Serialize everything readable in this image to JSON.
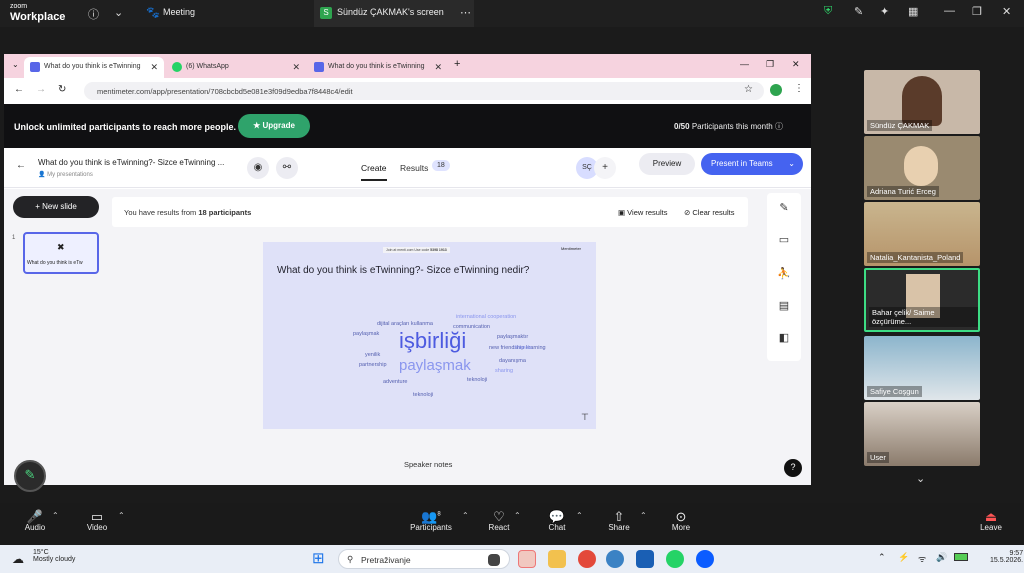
{
  "zoom": {
    "logo_top": "zoom",
    "logo_bottom": "Workplace",
    "meeting_label": "Meeting",
    "share_label": "Sündüz ÇAKMAK's screen",
    "toolbar": {
      "audio": "Audio",
      "video": "Video",
      "participants": "Participants",
      "participants_count": "8",
      "react": "React",
      "chat": "Chat",
      "share": "Share",
      "more": "More",
      "leave": "Leave"
    },
    "participants": [
      {
        "name": "Sündüz ÇAKMAK",
        "color": "#a89a8c"
      },
      {
        "name": "Adriana Turić Erceg",
        "color": "#9a8a70"
      },
      {
        "name": "Natalia_Kantanista_Poland",
        "color": "#b99b72"
      },
      {
        "name": "Bahar çelik/ Saime özçürüme...",
        "color": "#3a3a3a"
      },
      {
        "name": "Safiye Coşgun",
        "color": "#7fa8c0"
      },
      {
        "name": "User",
        "color": "#8b7b6c"
      }
    ]
  },
  "browser": {
    "tabs": [
      {
        "title": "What do you think is eTwinning",
        "color": "#5866e8"
      },
      {
        "title": "(6) WhatsApp",
        "color": "#25d366"
      },
      {
        "title": "What do you think is eTwinning",
        "color": "#5866e8"
      }
    ],
    "url": "mentimeter.com/app/presentation/708cbcbd5e081e3f09d9edba7f8448c4/edit"
  },
  "menti": {
    "banner_text": "Unlock unlimited participants to reach more people.",
    "upgrade_label": "Upgrade",
    "participants_month": "0/50",
    "participants_month_label": "Participants this month",
    "title": "What do you think is eTwinning?- Sizce eTwinning ...",
    "subtitle": "My presentations",
    "tab_create": "Create",
    "tab_results": "Results",
    "results_badge": "18",
    "avatar_initials": "SÇ",
    "preview_label": "Preview",
    "present_label": "Present in Teams",
    "new_slide_label": "New slide",
    "slide_number": "1",
    "thumb_title": "What do you think is eTw",
    "results_text_prefix": "You have results from",
    "results_count": "18 participants",
    "view_results": "View results",
    "clear_results": "Clear results",
    "slide_question": "What do you think is eTwinning?- Sizce eTwinning nedir?",
    "slide_join": "Join at menti.com  Use code",
    "slide_code": "5398 1913",
    "slide_brand": "Mentimeter",
    "speaker_notes": "Speaker notes",
    "help": "?",
    "wordcloud": [
      {
        "word": "işbirliği",
        "size": 22,
        "color": "#4d5be0"
      },
      {
        "word": "paylaşmak",
        "size": 15,
        "color": "#8a96ee"
      },
      {
        "word": "dijital araçları kullanma",
        "size": 5.5,
        "color": "#5560b0"
      },
      {
        "word": "teknoloji",
        "size": 5.5,
        "color": "#5560b0"
      },
      {
        "word": "communication",
        "size": 5.5,
        "color": "#5560b0"
      },
      {
        "word": "paylaşmak",
        "size": 5.5,
        "color": "#5560b0"
      },
      {
        "word": "paylaşmaktır",
        "size": 5.5,
        "color": "#5560b0"
      },
      {
        "word": "new friendship learning",
        "size": 5.5,
        "color": "#5560b0"
      },
      {
        "word": "friends",
        "size": 5.5,
        "color": "#8a96ee"
      },
      {
        "word": "yenilik",
        "size": 5.5,
        "color": "#5560b0"
      },
      {
        "word": "dayanışma",
        "size": 5.5,
        "color": "#5560b0"
      },
      {
        "word": "partnership",
        "size": 5.5,
        "color": "#5560b0"
      },
      {
        "word": "sharing",
        "size": 5.5,
        "color": "#8a96ee"
      },
      {
        "word": "adventure",
        "size": 5.5,
        "color": "#5560b0"
      },
      {
        "word": "international cooperation",
        "size": 5.5,
        "color": "#8a96ee"
      },
      {
        "word": "teknoloji",
        "size": 5.5,
        "color": "#5560b0"
      }
    ]
  },
  "taskbar": {
    "temp": "15°C",
    "weather": "Mostly cloudy",
    "search_placeholder": "Pretraživanje",
    "time": "9:57",
    "date": "15.5.2026."
  }
}
